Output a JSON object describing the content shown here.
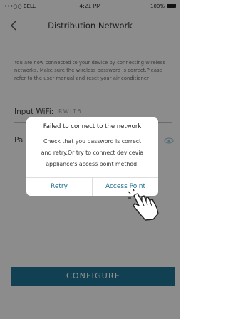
{
  "status_bar": {
    "carrier": "•••○○ BELL",
    "time": "4:21 PM",
    "battery": "100%"
  },
  "nav": {
    "title": "Distribution Network",
    "back_icon": "chevron-left-icon"
  },
  "info_text": "You are now connected to your device by connecting wireless networks. Make sure the wireless password is correct.Please refer to the user manual and reset your air conditioner",
  "form": {
    "wifi_label": "Input WiFi:",
    "wifi_value": "RWIT6",
    "password_label": "Pa",
    "eye_icon": "eye-icon"
  },
  "configure_label": "CONFIGURE",
  "dialog": {
    "title": "Failed to connect to the network",
    "message": "Check that you password is correct and retry.Or try to connect devicevia appliance's access point method.",
    "retry_label": "Retry",
    "access_point_label": "Access Point",
    "hand_icon": "pointing-hand-icon"
  },
  "colors": {
    "accent": "#1c6f8c",
    "overlay": "rgba(0,0,0,0.42)",
    "background": "#f2f2f2"
  }
}
